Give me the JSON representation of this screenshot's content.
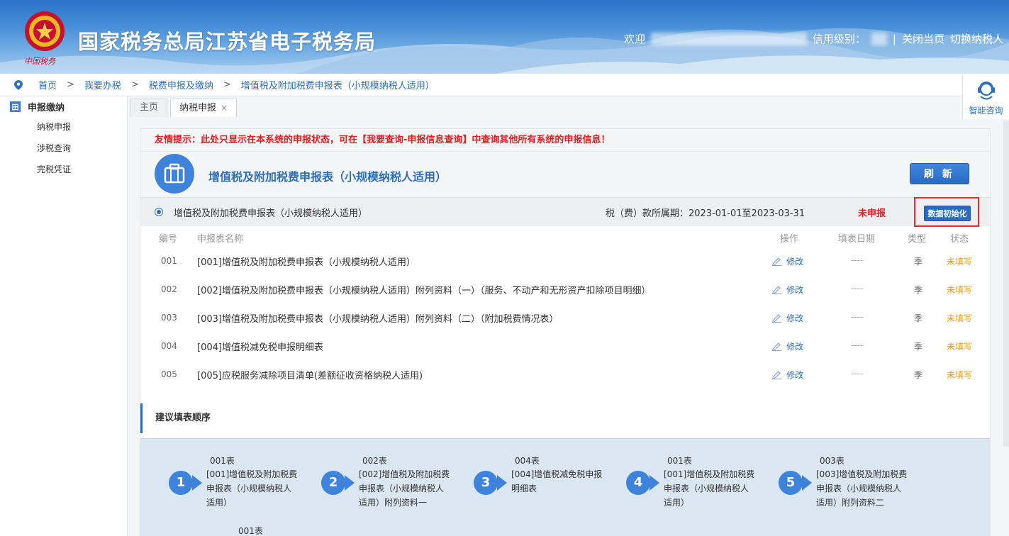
{
  "header": {
    "title": "国家税务总局江苏省电子税务局",
    "logo_text": "中国税务",
    "welcome": "欢迎",
    "credit_label": "信用级别：",
    "separator": "|",
    "close_page": "关闭当页",
    "switch_taxpayer": "切换纳税人"
  },
  "breadcrumb": [
    "首页",
    "我要办税",
    "税费申报及缴纳",
    "增值税及附加税费申报表（小规模纳税人适用）"
  ],
  "breadcrumb_sep": ">",
  "help": {
    "label": "智能咨询"
  },
  "sidebar": {
    "heading_icon": "田",
    "heading": "申报缴纳",
    "items": [
      "纳税申报",
      "涉税查询",
      "完税凭证"
    ]
  },
  "tabs": [
    {
      "label": "主页"
    },
    {
      "label": "纳税申报",
      "close": "×"
    }
  ],
  "notice": "友情提示：此处只显示在本系统的申报状态，可在【我要查询-申报信息查询】中查询其他所有系统的申报信息！",
  "form": {
    "title": "增值税及附加税费申报表（小规模纳税人适用）",
    "refresh_label": "刷 新"
  },
  "period": {
    "name": "增值税及附加税费申报表（小规模纳税人适用）",
    "label": "税（费）款所属期：2023-01-01至2023-03-31",
    "status": "未申报",
    "init_label": "数据初始化"
  },
  "table": {
    "headers": [
      "编号",
      "申报表名称",
      "操作",
      "填表日期",
      "类型",
      "状态"
    ],
    "rows": [
      {
        "no": "001",
        "name": "[001]增值税及附加税费申报表（小规模纳税人适用）",
        "op": "修改",
        "date": "----",
        "type": "季",
        "status": "未填写"
      },
      {
        "no": "002",
        "name": "[002]增值税及附加税费申报表（小规模纳税人适用）附列资料（一）（服务、不动产和无形资产扣除项目明细）",
        "op": "修改",
        "date": "----",
        "type": "季",
        "status": "未填写"
      },
      {
        "no": "003",
        "name": "[003]增值税及附加税费申报表（小规模纳税人适用）附列资料（二）（附加税费情况表）",
        "op": "修改",
        "date": "----",
        "type": "季",
        "status": "未填写"
      },
      {
        "no": "004",
        "name": "[004]增值税减免税申报明细表",
        "op": "修改",
        "date": "----",
        "type": "季",
        "status": "未填写"
      },
      {
        "no": "005",
        "name": "[005]应税服务减除项目清单(差额征收资格纳税人适用)",
        "op": "修改",
        "date": "----",
        "type": "季",
        "status": "未填写"
      }
    ]
  },
  "order": {
    "title": "建议填表顺序",
    "steps": [
      {
        "num": "1",
        "code": "001表",
        "text": "[001]增值税及附加税费申报表（小规模纳税人适用）"
      },
      {
        "num": "2",
        "code": "002表",
        "text": "[002]增值税及附加税费申报表（小规模纳税人适用）附列资料一"
      },
      {
        "num": "3",
        "code": "004表",
        "text": "[004]增值税减免税申报明细表"
      },
      {
        "num": "4",
        "code": "001表",
        "text": "[001]增值税及附加税费申报表（小规模纳税人适用）"
      },
      {
        "num": "5",
        "code": "003表",
        "text": "[003]增值税及附加税费申报表（小规模纳税人适用）附列资料二"
      }
    ],
    "next_code": "001表"
  },
  "colors": {
    "header_blue": "#2a73c9",
    "accent_blue": "#2d6fb8",
    "notice_red": "#e02020",
    "status_orange": "#e89a1a",
    "order_bg": "#dae7f3"
  },
  "icons": [
    "emblem-logo",
    "location-pin-icon",
    "customer-service-icon",
    "briefcase-icon",
    "pencil-icon",
    "arrow-right-icon"
  ]
}
